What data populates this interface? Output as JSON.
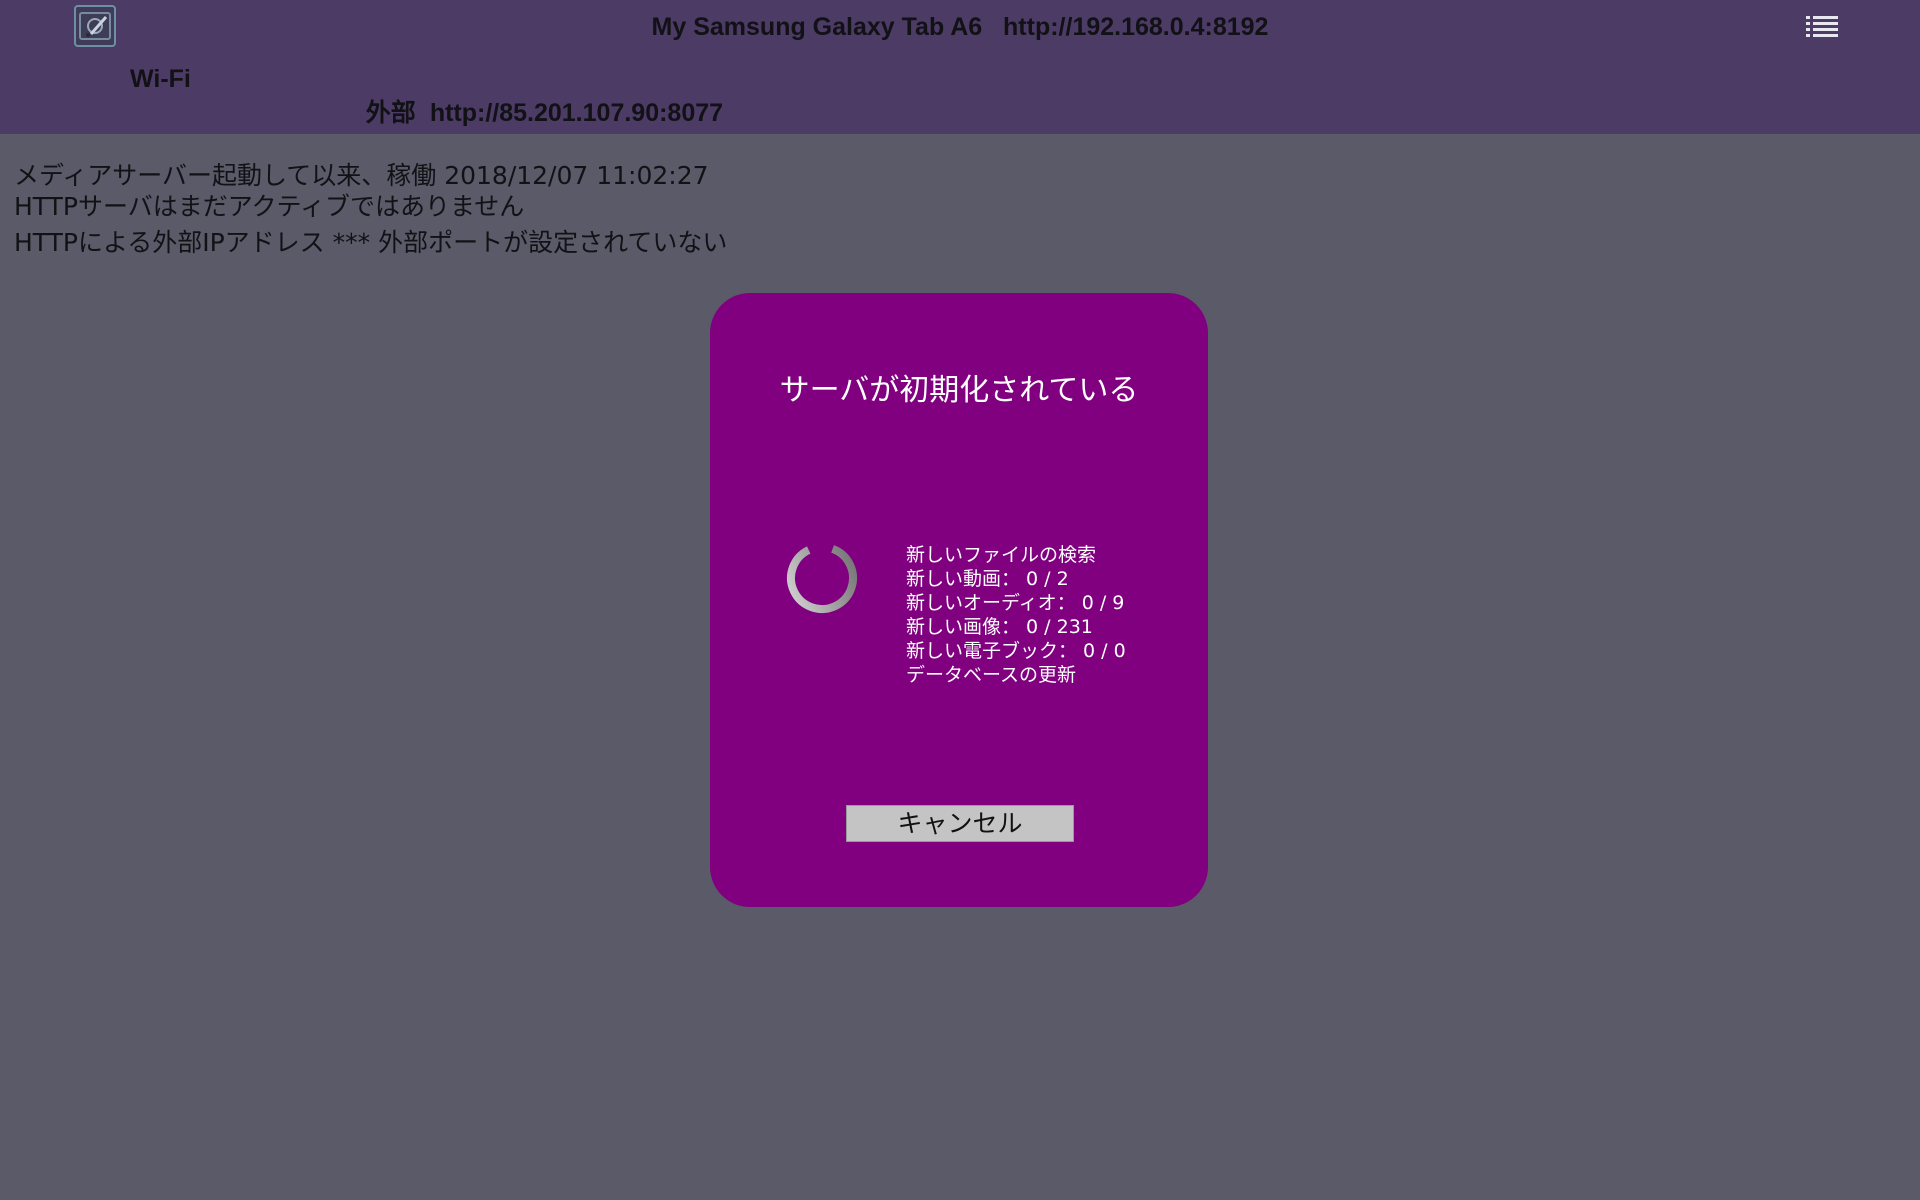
{
  "header": {
    "title": "My Samsung Galaxy Tab A6   http://192.168.0.4:8192",
    "wifi_label": "Wi-Fi",
    "external_label": "外部",
    "external_url": "http://85.201.107.90:8077",
    "app_icon": "media-server-app-icon",
    "menu_icon": "list-menu-icon"
  },
  "status": {
    "line1": "メディアサーバー起動して以来、稼働 2018/12/07 11:02:27",
    "line2": "HTTPサーバはまだアクティブではありません",
    "line3": "HTTPによる外部IPアドレス *** 外部ポートが設定されていない"
  },
  "dialog": {
    "title": "サーバが初期化されている",
    "spinner_icon": "loading-spinner-icon",
    "progress_lines": [
      "新しいファイルの検索",
      "新しい動画： 0 / 2",
      "新しいオーディオ： 0 / 9",
      "新しい画像： 0 / 231",
      "新しい電子ブック： 0 / 0",
      "データベースの更新"
    ],
    "cancel_label": "キャンセル"
  },
  "colors": {
    "background": "#5a5a68",
    "topbar": "#4c3b65",
    "dialog": "#800080",
    "button": "#c4c4c4"
  }
}
